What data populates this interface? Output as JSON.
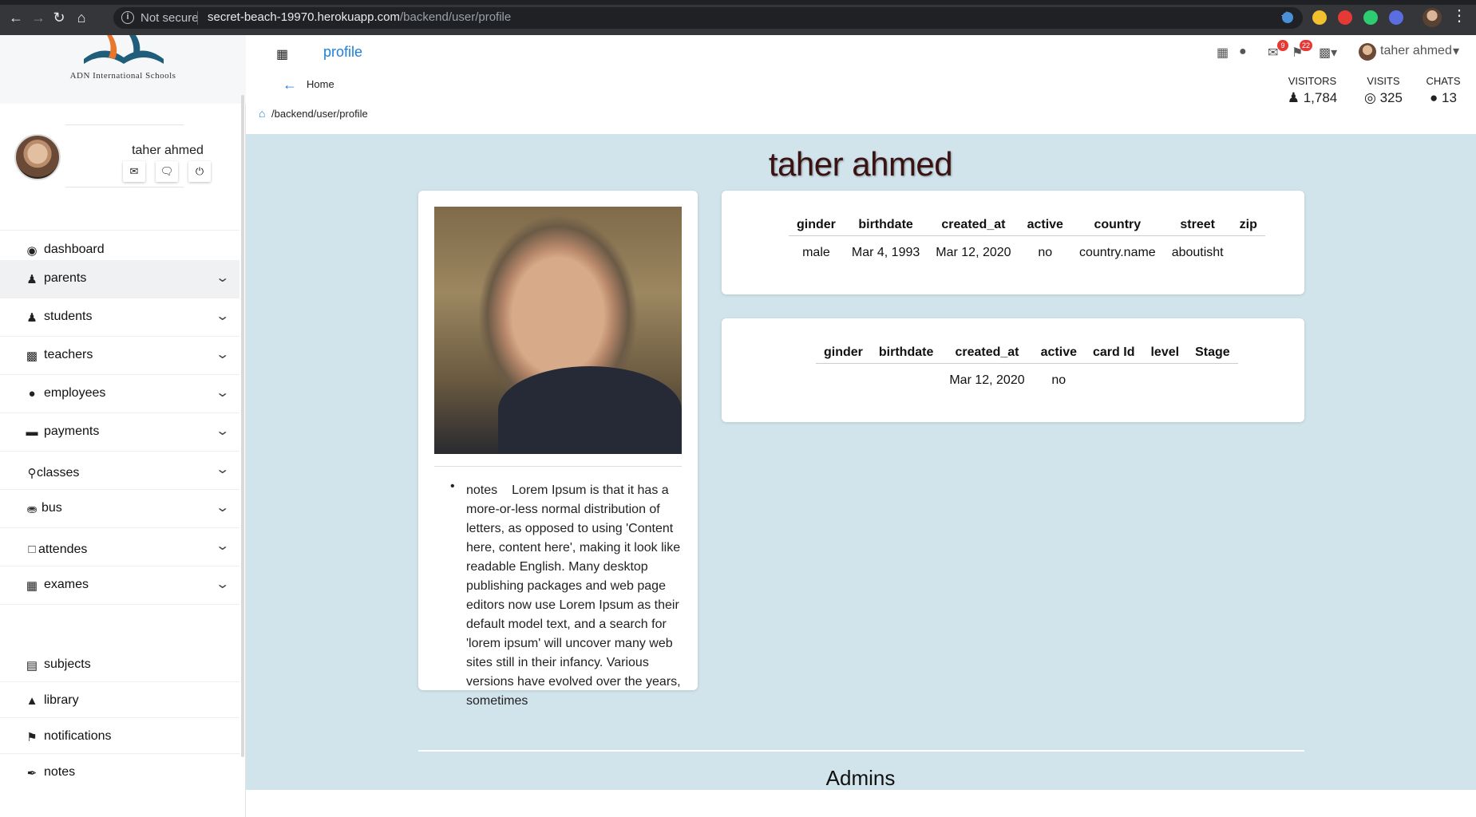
{
  "browser": {
    "security_label": "Not secure",
    "url_host": "secret-beach-19970.herokuapp.com",
    "url_path": "/backend/user/profile",
    "extension_colors": [
      "#4a90d9",
      "#f2c12e",
      "#e53935",
      "#2ecc71",
      "#5b6ee1"
    ]
  },
  "sidebar": {
    "logo_text": "ADN International Schools",
    "user_name": "taher ahmed",
    "items": [
      {
        "label": "dashboard",
        "icon": "tachometer-icon"
      },
      {
        "label": "parents",
        "icon": "users-icon"
      },
      {
        "label": "students",
        "icon": "student-icon"
      },
      {
        "label": "teachers",
        "icon": "chalkboard-teacher-icon"
      },
      {
        "label": "employees",
        "icon": "user-icon"
      },
      {
        "label": "payments",
        "icon": "wallet-icon"
      },
      {
        "label": "classes",
        "icon": "lightbulb-icon"
      },
      {
        "label": "bus",
        "icon": "bus-icon"
      },
      {
        "label": "attendes",
        "icon": "clipboard-icon"
      },
      {
        "label": "exames",
        "icon": "file-export-icon"
      },
      {
        "label": "subjects",
        "icon": "book-icon"
      },
      {
        "label": "library",
        "icon": "book-reader-icon"
      },
      {
        "label": "notifications",
        "icon": "bell-icon"
      },
      {
        "label": "notes",
        "icon": "feather-icon"
      }
    ]
  },
  "topbar": {
    "title": "profile",
    "mail_badge": "9",
    "notif_badge": "22",
    "user_name": "taher ahmed"
  },
  "subheader": {
    "home_label": "Home",
    "breadcrumb": "/backend/user/profile",
    "stats": [
      {
        "label": "VISITORS",
        "value": "1,784",
        "icon": "users-icon"
      },
      {
        "label": "VISITS",
        "value": "325",
        "icon": "globe-icon"
      },
      {
        "label": "CHATS",
        "value": "13",
        "icon": "comments-icon"
      }
    ]
  },
  "profile": {
    "name": "taher ahmed",
    "notes_label": "notes",
    "notes_text": "Lorem Ipsum is that it has a more-or-less normal distribution of letters, as opposed to using 'Content here, content here', making it look like readable English. Many desktop publishing packages and web page editors now use Lorem Ipsum as their default model text, and a search for 'lorem ipsum' will uncover many web sites still in their infancy. Various versions have evolved over the years, sometimes",
    "table1": {
      "headers": [
        "ginder",
        "birthdate",
        "created_at",
        "active",
        "country",
        "street",
        "zip"
      ],
      "row": [
        "male",
        "Mar 4, 1993",
        "Mar 12, 2020",
        "no",
        "country.name",
        "aboutisht",
        ""
      ]
    },
    "table2": {
      "headers": [
        "ginder",
        "birthdate",
        "created_at",
        "active",
        "card Id",
        "level",
        "Stage"
      ],
      "row": [
        "",
        "",
        "Mar 12, 2020",
        "no",
        "",
        "",
        ""
      ]
    },
    "admins_title": "Admins"
  }
}
